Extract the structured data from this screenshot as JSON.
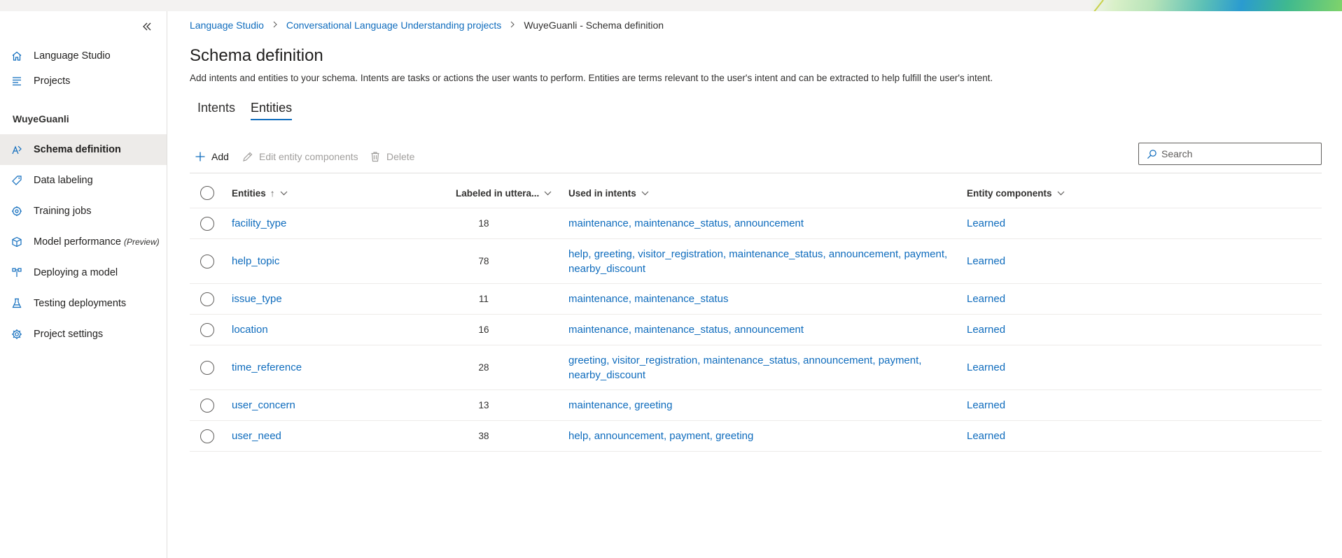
{
  "sidebar": {
    "collapse_icon": "double-chevron-left-icon",
    "project_name": "WuyeGuanli",
    "items": [
      {
        "label": "Language Studio",
        "icon": "home-icon"
      },
      {
        "label": "Projects",
        "icon": "list-icon"
      },
      {
        "label": "Schema definition",
        "icon": "schema-icon",
        "selected": true
      },
      {
        "label": "Data labeling",
        "icon": "tag-icon"
      },
      {
        "label": "Training jobs",
        "icon": "training-icon"
      },
      {
        "label": "Model performance",
        "suffix": "(Preview)",
        "icon": "cube-icon"
      },
      {
        "label": "Deploying a model",
        "icon": "deploy-icon"
      },
      {
        "label": "Testing deployments",
        "icon": "flask-icon"
      },
      {
        "label": "Project settings",
        "icon": "gear-icon"
      }
    ]
  },
  "breadcrumb": {
    "items": [
      "Language Studio",
      "Conversational Language Understanding projects"
    ],
    "current": "WuyeGuanli - Schema definition"
  },
  "page": {
    "title": "Schema definition",
    "description": "Add intents and entities to your schema. Intents are tasks or actions the user wants to perform. Entities are terms relevant to the user's intent and can be extracted to help fulfill the user's intent."
  },
  "tabs": [
    {
      "label": "Intents",
      "active": false
    },
    {
      "label": "Entities",
      "active": true
    }
  ],
  "toolbar": {
    "add_label": "Add",
    "edit_label": "Edit entity components",
    "delete_label": "Delete",
    "search_placeholder": "Search"
  },
  "grid": {
    "headers": {
      "entities": "Entities",
      "entities_sort": "↑",
      "labeled": "Labeled in uttera...",
      "used": "Used in intents",
      "components": "Entity components"
    },
    "rows": [
      {
        "entity": "facility_type",
        "count": "18",
        "intents": "maintenance, maintenance_status, announcement",
        "components": "Learned"
      },
      {
        "entity": "help_topic",
        "count": "78",
        "intents": "help, greeting, visitor_registration, maintenance_status, announcement, payment, nearby_discount",
        "components": "Learned"
      },
      {
        "entity": "issue_type",
        "count": "11",
        "intents": "maintenance, maintenance_status",
        "components": "Learned"
      },
      {
        "entity": "location",
        "count": "16",
        "intents": "maintenance, maintenance_status, announcement",
        "components": "Learned"
      },
      {
        "entity": "time_reference",
        "count": "28",
        "intents": "greeting, visitor_registration, maintenance_status, announcement, payment, nearby_discount",
        "components": "Learned"
      },
      {
        "entity": "user_concern",
        "count": "13",
        "intents": "maintenance, greeting",
        "components": "Learned"
      },
      {
        "entity": "user_need",
        "count": "38",
        "intents": "help, announcement, payment, greeting",
        "components": "Learned"
      }
    ]
  },
  "colors": {
    "accent": "#0f6cbd",
    "selected_nav_bg": "#edebe9"
  }
}
